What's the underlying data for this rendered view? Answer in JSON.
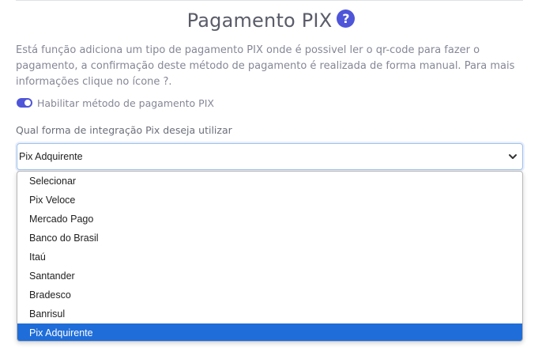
{
  "header": {
    "title": "Pagamento PIX",
    "help_icon": "?"
  },
  "description": "Está função adiciona um tipo de pagamento PIX onde é possivel ler o qr-code para fazer o pagamento, a confirmação deste método de pagamento é realizada de forma manual. Para mais informações clique no ícone ?.",
  "toggle": {
    "label": "Habilitar método de pagamento PIX",
    "enabled": true
  },
  "integration": {
    "label": "Qual forma de integração Pix deseja utilizar",
    "selected": "Pix Adquirente",
    "options": [
      "Selecionar",
      "Pix Veloce",
      "Mercado Pago",
      "Banco do Brasil",
      "Itaú",
      "Santander",
      "Bradesco",
      "Banrisul",
      "Pix Adquirente"
    ]
  },
  "colors": {
    "accent": "#4e55d9",
    "selected_option": "#1f6dd9"
  }
}
